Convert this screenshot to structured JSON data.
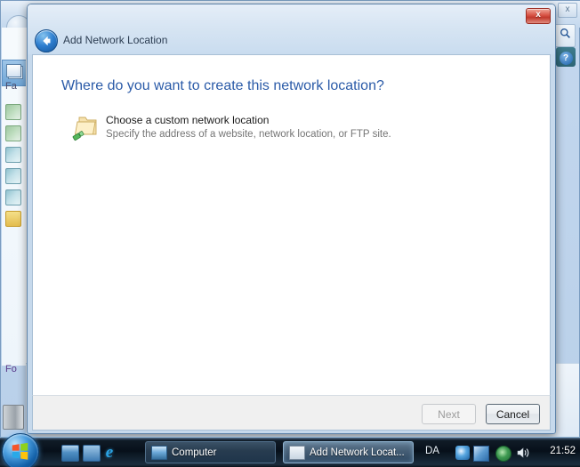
{
  "background_window": {
    "nav_header": "Fa",
    "nav_header_2": "Fo",
    "close_label": "x",
    "search_icon": "search-icon",
    "help_label": "?"
  },
  "dialog": {
    "title": "Add Network Location",
    "back_icon": "back-arrow-icon",
    "close_label": "x",
    "heading": "Where do you want to create this network location?",
    "option": {
      "icon": "network-folder-icon",
      "title": "Choose a custom network location",
      "subtitle": "Specify the address of a website, network location, or FTP site."
    },
    "buttons": {
      "next": "Next",
      "cancel": "Cancel"
    }
  },
  "taskbar": {
    "start_icon": "windows-start-orb-icon",
    "quick_launch": [
      {
        "icon": "show-desktop-icon"
      },
      {
        "icon": "switch-windows-icon"
      },
      {
        "icon": "internet-explorer-icon",
        "glyph": "e"
      }
    ],
    "tasks": [
      {
        "icon": "computer-icon",
        "label": "Computer"
      },
      {
        "icon": "window-icon",
        "label": "Add Network Locat..."
      }
    ],
    "language": "DA",
    "tray": [
      {
        "icon": "swirl-icon"
      },
      {
        "icon": "windows-cube-icon"
      },
      {
        "icon": "network-globe-icon"
      },
      {
        "icon": "volume-speaker-icon"
      }
    ],
    "clock": "21:52"
  },
  "colors": {
    "heading_blue": "#2b5ba8",
    "close_red": "#c2392c",
    "taskbar_dark": "#0a121b"
  }
}
